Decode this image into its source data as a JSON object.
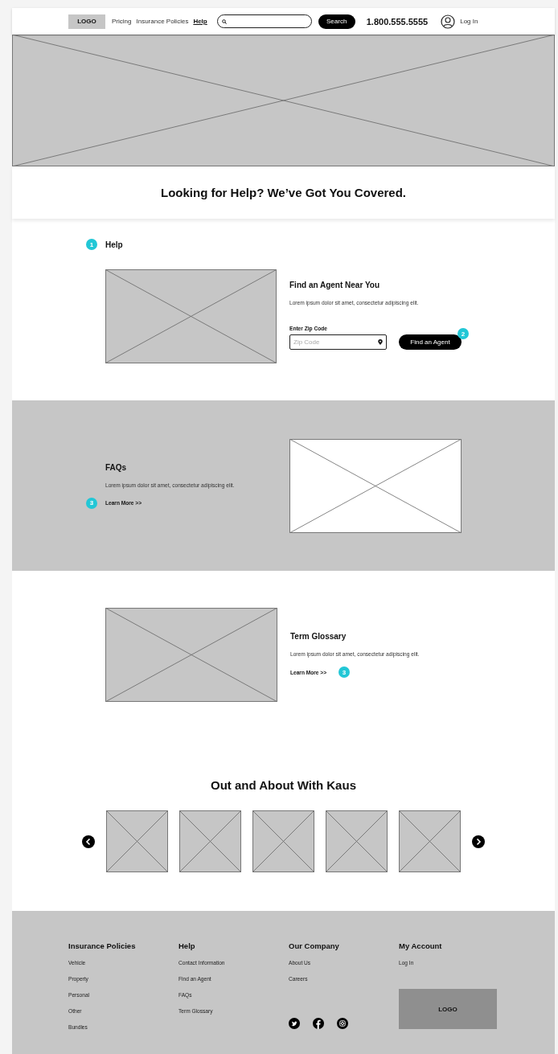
{
  "header": {
    "logo": "LOGO",
    "nav": [
      {
        "label": "Pricing",
        "selected": false
      },
      {
        "label": "Insurance Policies",
        "selected": false
      },
      {
        "label": "Help",
        "selected": true
      }
    ],
    "search_button": "Search",
    "phone": "1.800.555.5555",
    "login": "Log In"
  },
  "hero": {
    "title": "Looking for Help? We’ve Got You Covered."
  },
  "help_section": {
    "marker": "1",
    "heading": "Help",
    "title": "Find an Agent Near You",
    "body": "Lorem ipsum dolor sit amet, consectetur adipiscing elit.",
    "zip_label": "Enter Zip Code",
    "zip_field": {
      "placeholder": "Zip Code"
    },
    "button": "Find an Agent",
    "button_marker": "2"
  },
  "faqs": {
    "title": "FAQs",
    "body": "Lorem ipsum dolor sit amet, consectetur adipiscing elit.",
    "link": "Learn More >>",
    "marker": "3"
  },
  "glossary": {
    "title": "Term Glossary",
    "body": "Lorem ipsum dolor sit amet, consectetur adipiscing elit.",
    "link": "Learn More >>",
    "marker": "3"
  },
  "carousel": {
    "title": "Out and About With Kaus",
    "items": [
      {
        "kind": "placeholder"
      },
      {
        "kind": "placeholder"
      },
      {
        "kind": "placeholder"
      },
      {
        "kind": "placeholder"
      },
      {
        "kind": "placeholder"
      }
    ]
  },
  "footer": {
    "columns": [
      {
        "heading": "Insurance Policies",
        "links": [
          "Vehicle",
          "Property",
          "Personal",
          "Other",
          "Bundles"
        ]
      },
      {
        "heading": "Help",
        "links": [
          "Contact Information",
          "Find an Agent",
          "FAQs",
          "Term Glossary"
        ]
      },
      {
        "heading": "Our Company",
        "links": [
          "About Us",
          "Careers"
        ]
      },
      {
        "heading": "My Account",
        "links": [
          "Log In"
        ]
      }
    ],
    "social": [
      {
        "kind": "twitter"
      },
      {
        "kind": "facebook"
      },
      {
        "kind": "instagram"
      }
    ],
    "logo": "LOGO"
  }
}
